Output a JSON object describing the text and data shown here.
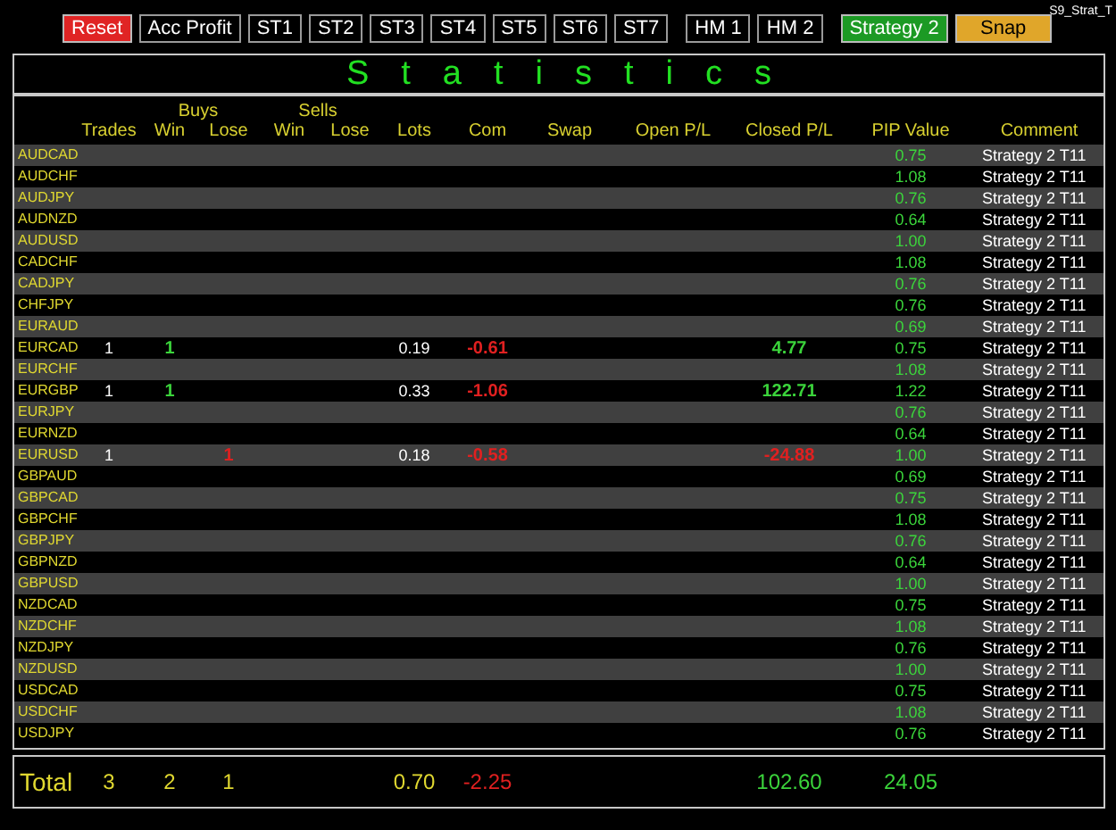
{
  "corner_label": "S9_Strat_T",
  "button_groups": [
    [
      {
        "label": "Reset",
        "color": "#e02424"
      },
      {
        "label": "Acc Profit"
      },
      {
        "label": "ST1"
      },
      {
        "label": "ST2"
      },
      {
        "label": "ST3"
      },
      {
        "label": "ST4"
      },
      {
        "label": "ST5"
      },
      {
        "label": "ST6"
      },
      {
        "label": "ST7"
      }
    ],
    [
      {
        "label": "HM 1"
      },
      {
        "label": "HM 2"
      }
    ],
    [
      {
        "label": "Strategy 2",
        "color": "#1c9a24"
      },
      {
        "label": "Snap",
        "color": "#e0a62a"
      }
    ]
  ],
  "title": "Statistics",
  "group_headers": {
    "buys": "Buys",
    "sells": "Sells"
  },
  "columns": [
    "Trades",
    "Win",
    "Lose",
    "Win",
    "Lose",
    "Lots",
    "Com",
    "Swap",
    "Open P/L",
    "Closed P/L",
    "PIP Value",
    "Comment"
  ],
  "rows": [
    {
      "symbol": "AUDCAD",
      "pip_value": "0.75",
      "comment": "Strategy 2 T11"
    },
    {
      "symbol": "AUDCHF",
      "pip_value": "1.08",
      "comment": "Strategy 2 T11"
    },
    {
      "symbol": "AUDJPY",
      "pip_value": "0.76",
      "comment": "Strategy 2 T11"
    },
    {
      "symbol": "AUDNZD",
      "pip_value": "0.64",
      "comment": "Strategy 2 T11"
    },
    {
      "symbol": "AUDUSD",
      "pip_value": "1.00",
      "comment": "Strategy 2 T11"
    },
    {
      "symbol": "CADCHF",
      "pip_value": "1.08",
      "comment": "Strategy 2 T11"
    },
    {
      "symbol": "CADJPY",
      "pip_value": "0.76",
      "comment": "Strategy 2 T11"
    },
    {
      "symbol": "CHFJPY",
      "pip_value": "0.76",
      "comment": "Strategy 2 T11"
    },
    {
      "symbol": "EURAUD",
      "pip_value": "0.69",
      "comment": "Strategy 2 T11"
    },
    {
      "symbol": "EURCAD",
      "trades": "1",
      "buy_win": {
        "text": "1",
        "color": "#3bd43b"
      },
      "lots": "0.19",
      "com": {
        "text": "-0.61",
        "color": "#e02020"
      },
      "closed_pl": {
        "text": "4.77",
        "color": "#3bd43b"
      },
      "pip_value": "0.75",
      "comment": "Strategy 2 T11"
    },
    {
      "symbol": "EURCHF",
      "pip_value": "1.08",
      "comment": "Strategy 2 T11"
    },
    {
      "symbol": "EURGBP",
      "trades": "1",
      "buy_win": {
        "text": "1",
        "color": "#3bd43b"
      },
      "lots": "0.33",
      "com": {
        "text": "-1.06",
        "color": "#e02020"
      },
      "closed_pl": {
        "text": "122.71",
        "color": "#3bd43b"
      },
      "pip_value": "1.22",
      "comment": "Strategy 2 T11"
    },
    {
      "symbol": "EURJPY",
      "pip_value": "0.76",
      "comment": "Strategy 2 T11"
    },
    {
      "symbol": "EURNZD",
      "pip_value": "0.64",
      "comment": "Strategy 2 T11"
    },
    {
      "symbol": "EURUSD",
      "trades": "1",
      "buy_lose": {
        "text": "1",
        "color": "#e02020"
      },
      "lots": "0.18",
      "com": {
        "text": "-0.58",
        "color": "#e02020"
      },
      "closed_pl": {
        "text": "-24.88",
        "color": "#e02020"
      },
      "pip_value": "1.00",
      "comment": "Strategy 2 T11"
    },
    {
      "symbol": "GBPAUD",
      "pip_value": "0.69",
      "comment": "Strategy 2 T11"
    },
    {
      "symbol": "GBPCAD",
      "pip_value": "0.75",
      "comment": "Strategy 2 T11"
    },
    {
      "symbol": "GBPCHF",
      "pip_value": "1.08",
      "comment": "Strategy 2 T11"
    },
    {
      "symbol": "GBPJPY",
      "pip_value": "0.76",
      "comment": "Strategy 2 T11"
    },
    {
      "symbol": "GBPNZD",
      "pip_value": "0.64",
      "comment": "Strategy 2 T11"
    },
    {
      "symbol": "GBPUSD",
      "pip_value": "1.00",
      "comment": "Strategy 2 T11"
    },
    {
      "symbol": "NZDCAD",
      "pip_value": "0.75",
      "comment": "Strategy 2 T11"
    },
    {
      "symbol": "NZDCHF",
      "pip_value": "1.08",
      "comment": "Strategy 2 T11"
    },
    {
      "symbol": "NZDJPY",
      "pip_value": "0.76",
      "comment": "Strategy 2 T11"
    },
    {
      "symbol": "NZDUSD",
      "pip_value": "1.00",
      "comment": "Strategy 2 T11"
    },
    {
      "symbol": "USDCAD",
      "pip_value": "0.75",
      "comment": "Strategy 2 T11"
    },
    {
      "symbol": "USDCHF",
      "pip_value": "1.08",
      "comment": "Strategy 2 T11"
    },
    {
      "symbol": "USDJPY",
      "pip_value": "0.76",
      "comment": "Strategy 2 T11"
    }
  ],
  "total": {
    "label": "Total",
    "trades": "3",
    "buy_win": "2",
    "buy_lose": "1",
    "lots": "0.70",
    "com": {
      "text": "-2.25",
      "color": "#e02020"
    },
    "closed_pl": {
      "text": "102.60",
      "color": "#3bd43b"
    },
    "pip_value": "24.05"
  }
}
